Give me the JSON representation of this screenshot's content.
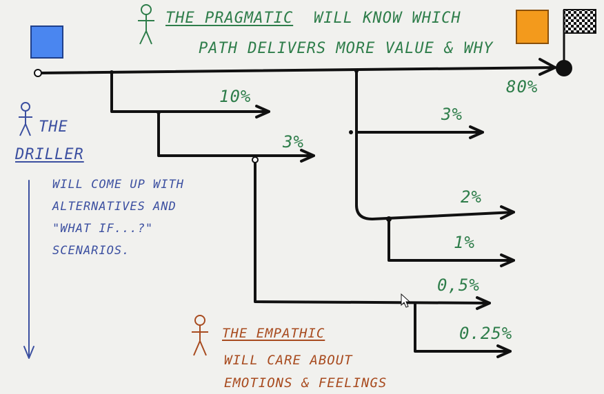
{
  "colors": {
    "background": "#f1f1ee",
    "line": "#111111",
    "pragmatic": "#2e7d4a",
    "driller": "#3b4fa0",
    "empathic": "#a84b1f",
    "start_box": "#4a86f0",
    "end_box": "#f39a1c"
  },
  "icons": {
    "start": "blue-square-icon",
    "end": "orange-square-icon",
    "finish": "checkered-flag-icon",
    "person": "stick-figure-icon",
    "cursor": "mouse-pointer-icon"
  },
  "pragmatic": {
    "title": "THE PRAGMATIC",
    "line1": "WILL KNOW WHICH",
    "line2": "PATH DELIVERS MORE VALUE & WHY"
  },
  "driller": {
    "title_1": "THE",
    "title_2": "DRILLER",
    "desc": [
      "WILL COME UP WITH",
      "ALTERNATIVES AND",
      "\"WHAT IF...?\"",
      "SCENARIOS."
    ]
  },
  "empathic": {
    "title": "THE EMPATHIC",
    "line1": "WILL CARE ABOUT",
    "line2": "EMOTIONS & FEELINGS"
  },
  "percentages": {
    "main": "80%",
    "p10": "10%",
    "p3a": "3%",
    "p3b": "3%",
    "p2": "2%",
    "p1": "1%",
    "p05": "0,5%",
    "p025": "0.25%"
  }
}
